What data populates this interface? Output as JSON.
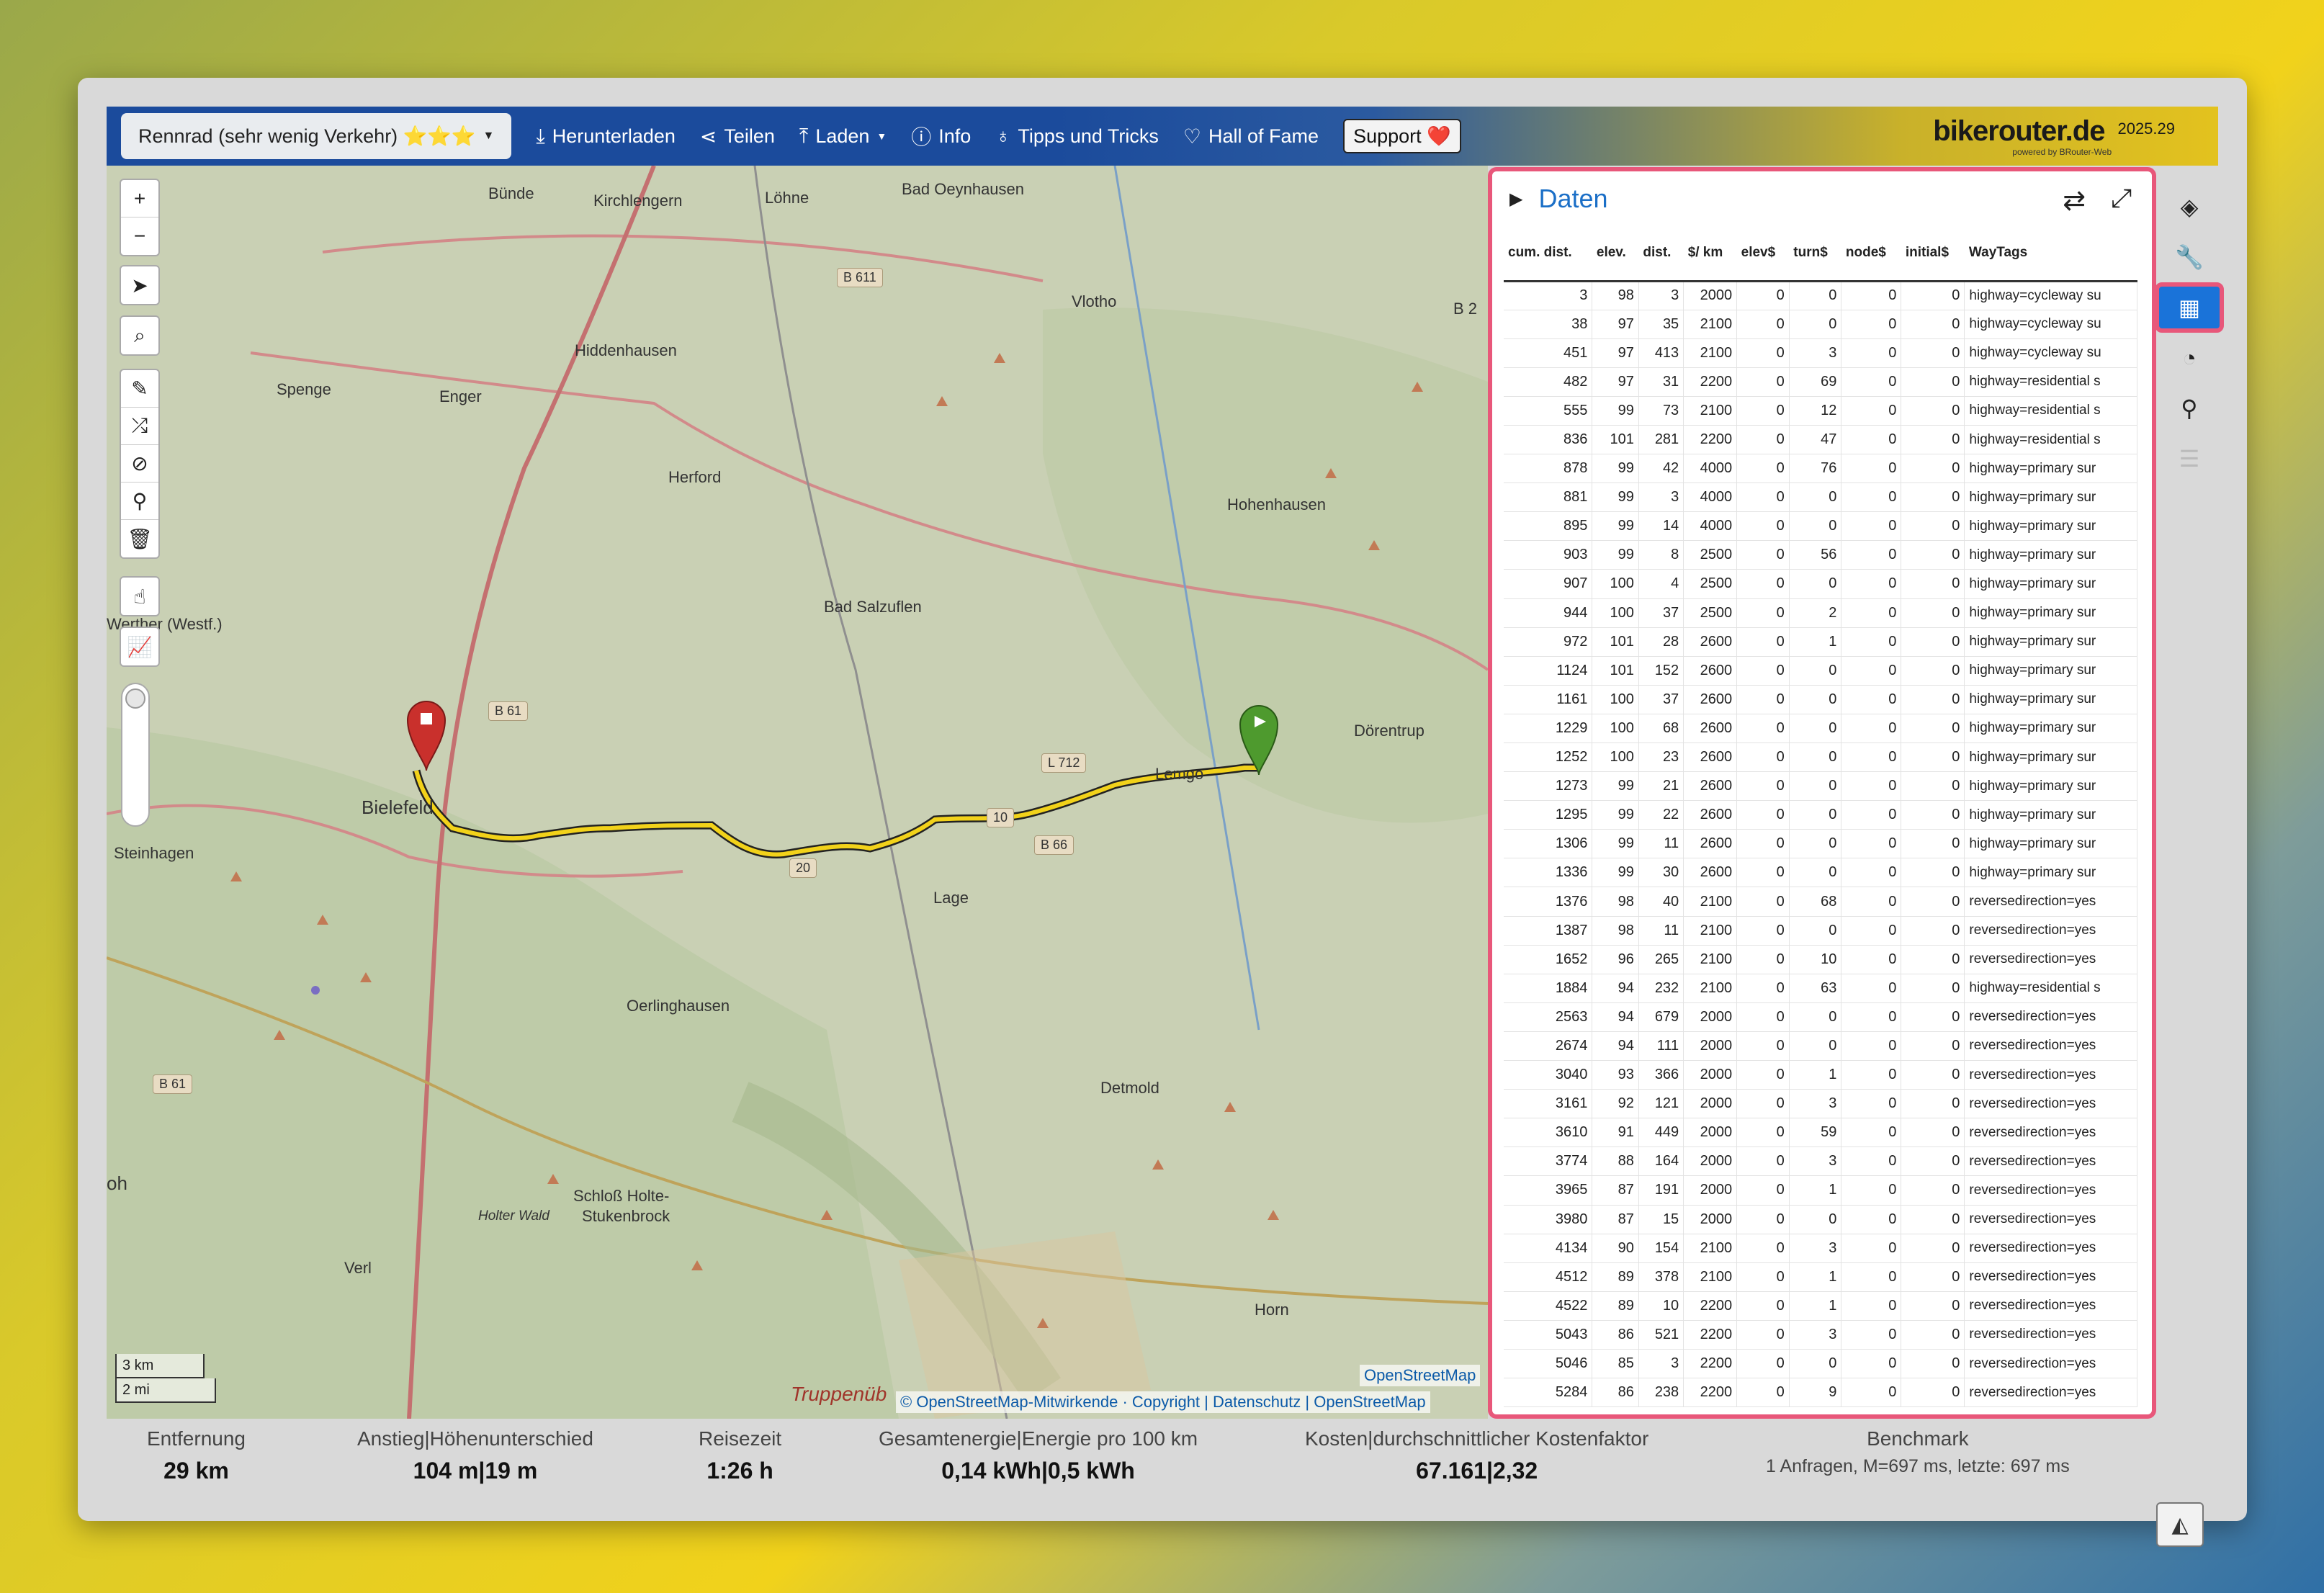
{
  "navbar": {
    "profile": "Rennrad (sehr wenig Verkehr) ⭐⭐⭐",
    "items": [
      {
        "label": "Herunterladen",
        "icon": "download-icon"
      },
      {
        "label": "Teilen",
        "icon": "share-icon"
      },
      {
        "label": "Laden",
        "icon": "upload-icon"
      },
      {
        "label": "Info",
        "icon": "info-icon"
      },
      {
        "label": "Tipps und Tricks",
        "icon": "lightbulb-icon"
      },
      {
        "label": "Hall of Fame",
        "icon": "heart-icon"
      }
    ],
    "support": "Support ❤️",
    "brand": "bikerouter.de",
    "brand_sub": "powered by BRouter-Web",
    "version": "2025.29"
  },
  "map": {
    "labels": {
      "bunde": "Bünde",
      "kirchlengern": "Kirchlengern",
      "lohne": "Löhne",
      "bad_oeynhausen": "Bad Oeynhausen",
      "vlotho": "Vlotho",
      "hiddenhausen": "Hiddenhausen",
      "spenge": "Spenge",
      "enger": "Enger",
      "herford": "Herford",
      "hohenhausen": "Hohenhausen",
      "bad_salzuflen": "Bad Salzuflen",
      "werther": "Werther (Westf.)",
      "dorentrup": "Dörentrup",
      "bielefeld": "Bielefeld",
      "lemgo": "Lemgo",
      "steinhagen": "Steinhagen",
      "lage": "Lage",
      "oerlinghausen": "Oerlinghausen",
      "detmold": "Detmold",
      "schloss": "Schloß Holte-",
      "stukenbrock": "Stukenbrock",
      "holter_wald": "Holter Wald",
      "verl": "Verl",
      "horn": "Horn",
      "truppenub": "Truppenüb",
      "b2": "B 2",
      "oh": "oh"
    },
    "badges": {
      "b611": "B 611",
      "b61": "B 61",
      "b61b": "B 61",
      "l712": "L 712",
      "b66": "B 66"
    },
    "scale": {
      "km": "3 km",
      "mi": "2 mi"
    },
    "attribution": {
      "osm_mitwirkende": "© OpenStreetMap-Mitwirkende",
      "copyright": "Copyright",
      "datenschutz": "Datenschutz",
      "osm": "OpenStreetMap",
      "osm_top": "OpenStreetMap"
    },
    "route_markers": {
      "a": "20",
      "b": "10"
    }
  },
  "panel": {
    "title": "Daten",
    "columns": [
      "cum. dist.",
      "elev.",
      "dist.",
      "$/ km",
      "elev$",
      "turn$",
      "node$",
      "initial$",
      "WayTags"
    ],
    "rows": [
      [
        "3",
        "98",
        "3",
        "2000",
        "0",
        "0",
        "0",
        "0",
        "highway=cycleway su"
      ],
      [
        "38",
        "97",
        "35",
        "2100",
        "0",
        "0",
        "0",
        "0",
        "highway=cycleway su"
      ],
      [
        "451",
        "97",
        "413",
        "2100",
        "0",
        "3",
        "0",
        "0",
        "highway=cycleway su"
      ],
      [
        "482",
        "97",
        "31",
        "2200",
        "0",
        "69",
        "0",
        "0",
        "highway=residential s"
      ],
      [
        "555",
        "99",
        "73",
        "2100",
        "0",
        "12",
        "0",
        "0",
        "highway=residential s"
      ],
      [
        "836",
        "101",
        "281",
        "2200",
        "0",
        "47",
        "0",
        "0",
        "highway=residential s"
      ],
      [
        "878",
        "99",
        "42",
        "4000",
        "0",
        "76",
        "0",
        "0",
        "highway=primary sur"
      ],
      [
        "881",
        "99",
        "3",
        "4000",
        "0",
        "0",
        "0",
        "0",
        "highway=primary sur"
      ],
      [
        "895",
        "99",
        "14",
        "4000",
        "0",
        "0",
        "0",
        "0",
        "highway=primary sur"
      ],
      [
        "903",
        "99",
        "8",
        "2500",
        "0",
        "56",
        "0",
        "0",
        "highway=primary sur"
      ],
      [
        "907",
        "100",
        "4",
        "2500",
        "0",
        "0",
        "0",
        "0",
        "highway=primary sur"
      ],
      [
        "944",
        "100",
        "37",
        "2500",
        "0",
        "2",
        "0",
        "0",
        "highway=primary sur"
      ],
      [
        "972",
        "101",
        "28",
        "2600",
        "0",
        "1",
        "0",
        "0",
        "highway=primary sur"
      ],
      [
        "1124",
        "101",
        "152",
        "2600",
        "0",
        "0",
        "0",
        "0",
        "highway=primary sur"
      ],
      [
        "1161",
        "100",
        "37",
        "2600",
        "0",
        "0",
        "0",
        "0",
        "highway=primary sur"
      ],
      [
        "1229",
        "100",
        "68",
        "2600",
        "0",
        "0",
        "0",
        "0",
        "highway=primary sur"
      ],
      [
        "1252",
        "100",
        "23",
        "2600",
        "0",
        "0",
        "0",
        "0",
        "highway=primary sur"
      ],
      [
        "1273",
        "99",
        "21",
        "2600",
        "0",
        "0",
        "0",
        "0",
        "highway=primary sur"
      ],
      [
        "1295",
        "99",
        "22",
        "2600",
        "0",
        "0",
        "0",
        "0",
        "highway=primary sur"
      ],
      [
        "1306",
        "99",
        "11",
        "2600",
        "0",
        "0",
        "0",
        "0",
        "highway=primary sur"
      ],
      [
        "1336",
        "99",
        "30",
        "2600",
        "0",
        "0",
        "0",
        "0",
        "highway=primary sur"
      ],
      [
        "1376",
        "98",
        "40",
        "2100",
        "0",
        "68",
        "0",
        "0",
        "reversedirection=yes"
      ],
      [
        "1387",
        "98",
        "11",
        "2100",
        "0",
        "0",
        "0",
        "0",
        "reversedirection=yes"
      ],
      [
        "1652",
        "96",
        "265",
        "2100",
        "0",
        "10",
        "0",
        "0",
        "reversedirection=yes"
      ],
      [
        "1884",
        "94",
        "232",
        "2100",
        "0",
        "63",
        "0",
        "0",
        "highway=residential s"
      ],
      [
        "2563",
        "94",
        "679",
        "2000",
        "0",
        "0",
        "0",
        "0",
        "reversedirection=yes"
      ],
      [
        "2674",
        "94",
        "111",
        "2000",
        "0",
        "0",
        "0",
        "0",
        "reversedirection=yes"
      ],
      [
        "3040",
        "93",
        "366",
        "2000",
        "0",
        "1",
        "0",
        "0",
        "reversedirection=yes"
      ],
      [
        "3161",
        "92",
        "121",
        "2000",
        "0",
        "3",
        "0",
        "0",
        "reversedirection=yes"
      ],
      [
        "3610",
        "91",
        "449",
        "2000",
        "0",
        "59",
        "0",
        "0",
        "reversedirection=yes"
      ],
      [
        "3774",
        "88",
        "164",
        "2000",
        "0",
        "3",
        "0",
        "0",
        "reversedirection=yes"
      ],
      [
        "3965",
        "87",
        "191",
        "2000",
        "0",
        "1",
        "0",
        "0",
        "reversedirection=yes"
      ],
      [
        "3980",
        "87",
        "15",
        "2000",
        "0",
        "0",
        "0",
        "0",
        "reversedirection=yes"
      ],
      [
        "4134",
        "90",
        "154",
        "2100",
        "0",
        "3",
        "0",
        "0",
        "reversedirection=yes"
      ],
      [
        "4512",
        "89",
        "378",
        "2100",
        "0",
        "1",
        "0",
        "0",
        "reversedirection=yes"
      ],
      [
        "4522",
        "89",
        "10",
        "2200",
        "0",
        "1",
        "0",
        "0",
        "reversedirection=yes"
      ],
      [
        "5043",
        "86",
        "521",
        "2200",
        "0",
        "3",
        "0",
        "0",
        "reversedirection=yes"
      ],
      [
        "5046",
        "85",
        "3",
        "2200",
        "0",
        "0",
        "0",
        "0",
        "reversedirection=yes"
      ],
      [
        "5284",
        "86",
        "238",
        "2200",
        "0",
        "9",
        "0",
        "0",
        "reversedirection=yes"
      ]
    ]
  },
  "stats": {
    "distance": {
      "label": "Entfernung",
      "value": "29 km"
    },
    "ascent": {
      "label": "Anstieg|Höhenunterschied",
      "value": "104 m|19 m"
    },
    "time": {
      "label": "Reisezeit",
      "value": "1:26 h"
    },
    "energy": {
      "label": "Gesamtenergie|Energie pro 100 km",
      "value": "0,14 kWh|0,5 kWh"
    },
    "cost": {
      "label": "Kosten|durchschnittlicher Kostenfaktor",
      "value": "67.161|2,32"
    },
    "benchmark": {
      "label": "Benchmark",
      "value": "1 Anfragen, M=697 ms, letzte: 697 ms"
    }
  }
}
